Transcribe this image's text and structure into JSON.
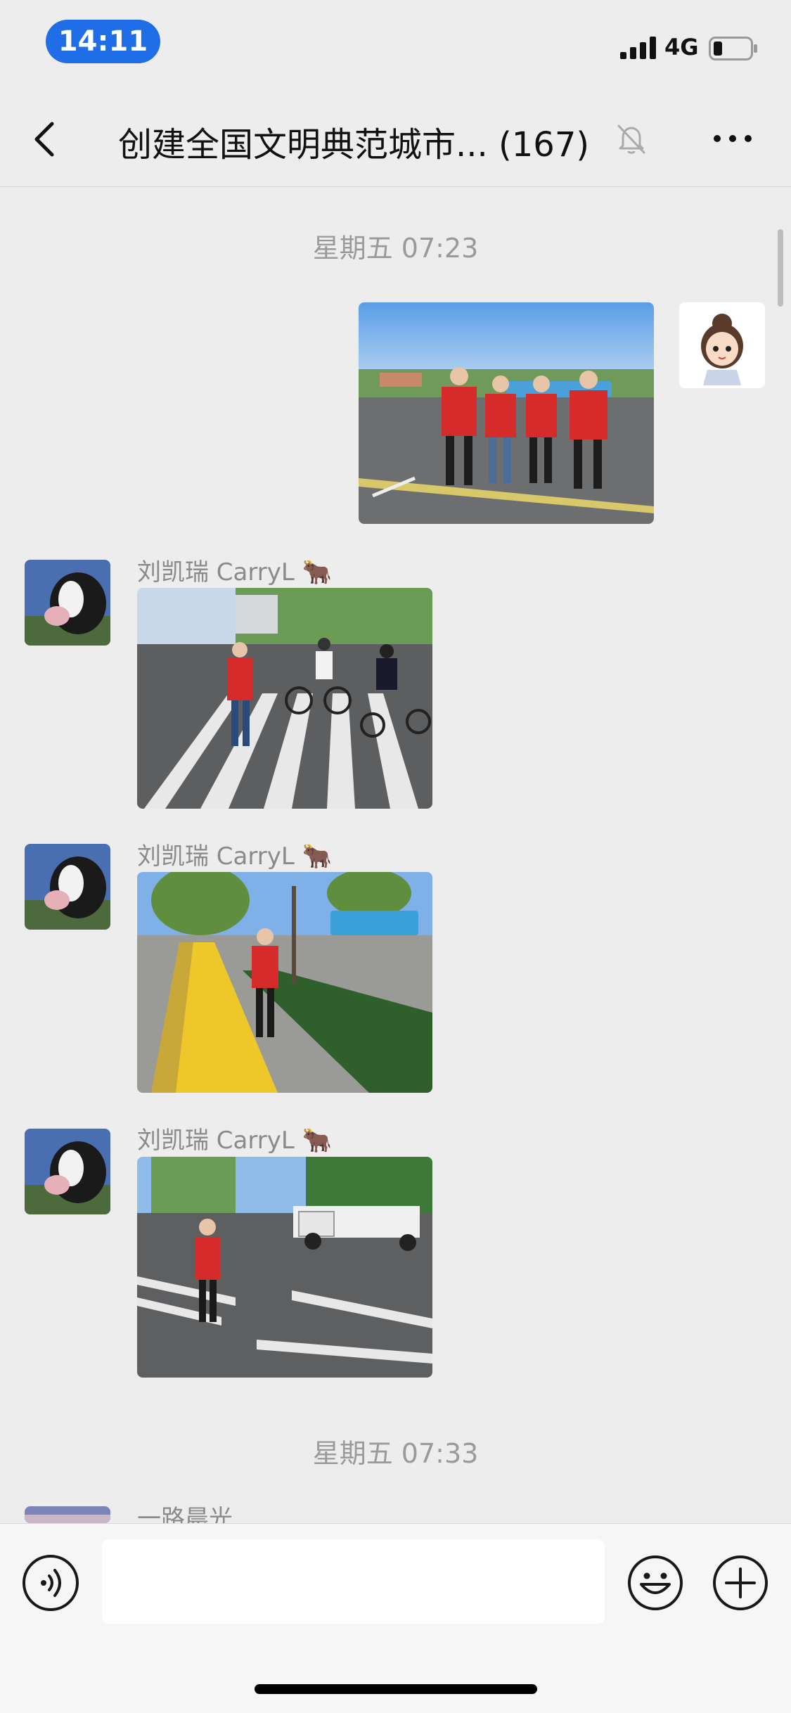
{
  "status_bar": {
    "time": "14:11",
    "network": "4G"
  },
  "nav": {
    "title": "创建全国文明典范城市... (167)"
  },
  "messages": {
    "timestamp_1": "星期五 07:23",
    "sender_1": "刘凯瑞 CarryL 🐂",
    "sender_2": "刘凯瑞 CarryL 🐂",
    "sender_3": "刘凯瑞 CarryL 🐂",
    "timestamp_2": "星期五 07:33",
    "sender_4": "一路晨光"
  },
  "input": {
    "placeholder": ""
  },
  "icons": {
    "back": "chevron-left-icon",
    "mute": "bell-slash-icon",
    "more": "ellipsis-icon",
    "voice": "voice-icon",
    "emoji": "smiley-icon",
    "plus": "plus-icon"
  },
  "colors": {
    "time_pill": "#1f6ee8",
    "background": "#ededed"
  }
}
